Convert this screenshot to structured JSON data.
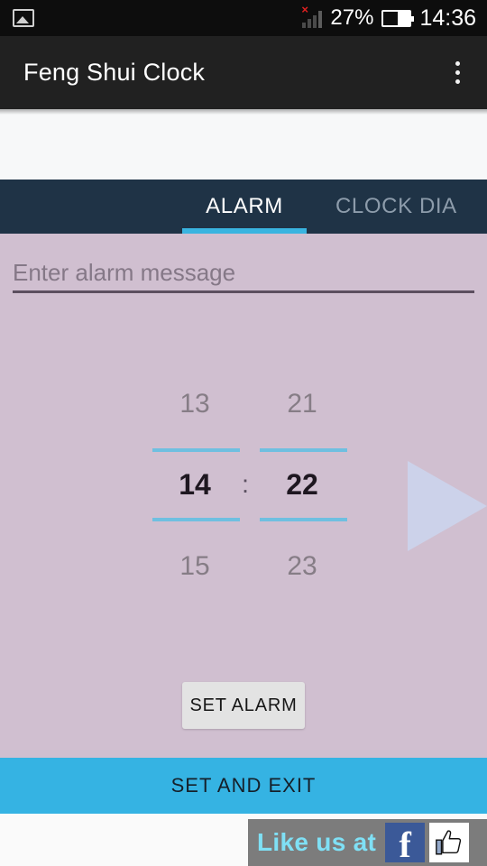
{
  "status_bar": {
    "notification_icon": "photo-icon",
    "signal_icon": "signal-bars-no-service-icon",
    "battery_percent": "27%",
    "battery_icon": "battery-icon",
    "time": "14:36"
  },
  "app_bar": {
    "title": "Feng Shui Clock",
    "overflow_icon": "overflow-menu-icon"
  },
  "tabs": [
    {
      "label": "ALARM",
      "active": true
    },
    {
      "label": "CLOCK DIA",
      "active": false
    }
  ],
  "alarm_form": {
    "message_placeholder": "Enter alarm message",
    "message_value": ""
  },
  "time_picker": {
    "hour": {
      "previous": "13",
      "current": "14",
      "next": "15"
    },
    "minute": {
      "previous": "21",
      "current": "22",
      "next": "23"
    },
    "separator": ":",
    "next_arrow_icon": "play-triangle-icon"
  },
  "buttons": {
    "set_alarm": "SET ALARM",
    "set_and_exit": "SET AND EXIT"
  },
  "banner": {
    "text": "Like us at",
    "facebook_glyph": "f",
    "facebook_icon": "facebook-logo-icon",
    "thumbs_up_icon": "thumbs-up-icon"
  },
  "colors": {
    "status_bar": "#0d0d0d",
    "app_bar": "#212121",
    "tab_bar": "#1f3346",
    "tab_indicator": "#39b4e0",
    "content_background": "#d0bfd0",
    "picker_line": "#6fbfe0",
    "set_and_exit": "#35b3e3",
    "banner_background": "#7c7c7c",
    "banner_text": "#7fe0f5",
    "facebook_blue": "#3b5998"
  }
}
